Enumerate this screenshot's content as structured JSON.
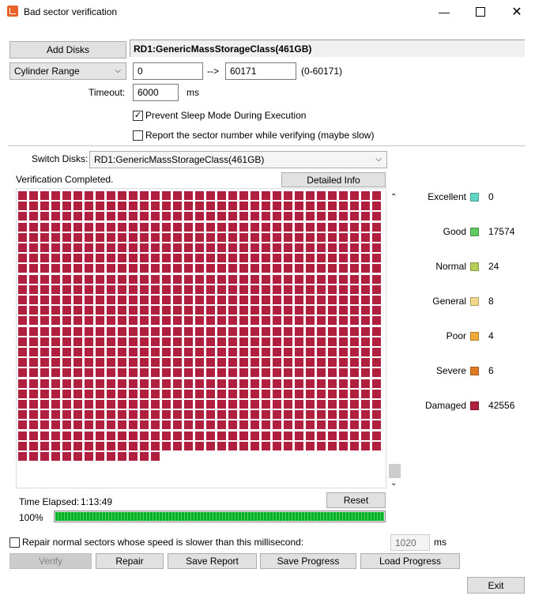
{
  "window": {
    "title": "Bad sector verification"
  },
  "toolbar": {
    "add_disks_label": "Add Disks",
    "disk_name": "RD1:GenericMassStorageClass(461GB)"
  },
  "range": {
    "mode": "Cylinder Range",
    "start": "0",
    "arrow": "-->",
    "end": "60171",
    "hint": "(0-60171)"
  },
  "timeout": {
    "label": "Timeout:",
    "value": "6000",
    "unit": "ms"
  },
  "options": {
    "prevent_sleep": {
      "label": "Prevent Sleep Mode During Execution",
      "checked": true,
      "mark": "✓"
    },
    "report_sector": {
      "label": "Report the sector number while verifying (maybe slow)",
      "checked": false,
      "mark": ""
    }
  },
  "switch": {
    "label": "Switch Disks:",
    "value": "RD1:GenericMassStorageClass(461GB)"
  },
  "status": {
    "text": "Verification Completed.",
    "detail_label": "Detailed Info"
  },
  "legend": [
    {
      "label": "Excellent",
      "count": "0",
      "color": "#5fd6c4"
    },
    {
      "label": "Good",
      "count": "17574",
      "color": "#5fc95f"
    },
    {
      "label": "Normal",
      "count": "24",
      "color": "#b3cf5a"
    },
    {
      "label": "General",
      "count": "8",
      "color": "#f2d88a"
    },
    {
      "label": "Poor",
      "count": "4",
      "color": "#f2a93b"
    },
    {
      "label": "Severe",
      "count": "6",
      "color": "#e07b24"
    },
    {
      "label": "Damaged",
      "count": "42556",
      "color": "#b0203e"
    }
  ],
  "sector_grid": {
    "color": "#b0203e",
    "full_rows": 25,
    "cols": 33,
    "last_row_cells": 13
  },
  "time": {
    "label": "Time Elapsed:",
    "value": "1:13:49",
    "reset_label": "Reset"
  },
  "progress": {
    "percent_text": "100%",
    "value": 1.0
  },
  "repair": {
    "label": "Repair normal sectors whose speed is slower than this millisecond:",
    "checked": false,
    "mark": "",
    "value": "1020",
    "unit": "ms"
  },
  "actions": {
    "verify": "Verify",
    "repair": "Repair",
    "save_report": "Save Report",
    "save_progress": "Save Progress",
    "load_progress": "Load Progress",
    "exit": "Exit"
  }
}
